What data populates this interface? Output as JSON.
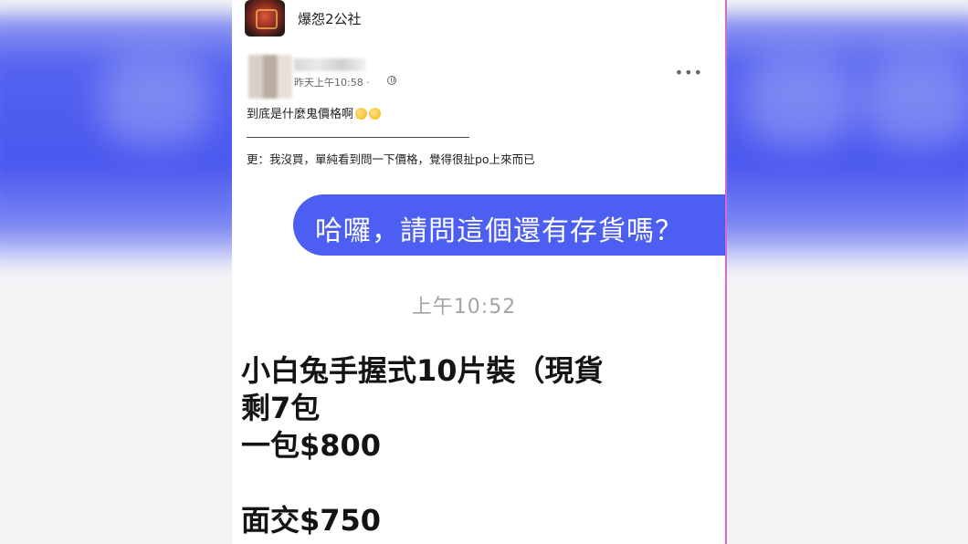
{
  "group": {
    "name": "爆怨2公社"
  },
  "post": {
    "time": "昨天上午10:58 · ",
    "text_line1": "到底是什麼鬼價格啊",
    "text_line2": "更：我沒買，單純看到問一下價格，覺得很扯po上來而已",
    "more": "•••"
  },
  "chat": {
    "question": "哈囉，請問這個還有存貨嗎？",
    "time": "上午10:52",
    "reply": "小白兔手握式10片裝（現貨\n剩7包\n一包$800\n\n面交$750"
  },
  "icons": [
    "globe-icon",
    "more-options-icon",
    "emoji-icon"
  ],
  "colors": {
    "bubble": "#4d5ef2",
    "side_blue": "#4a58ef"
  }
}
